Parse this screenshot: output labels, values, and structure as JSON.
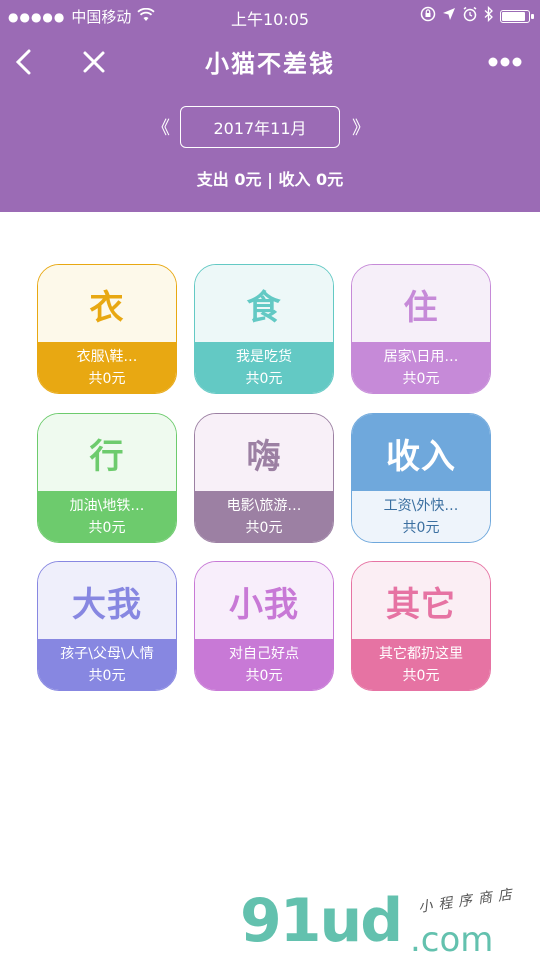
{
  "status_bar": {
    "signal": "●●●●●",
    "carrier": "中国移动",
    "time": "上午10:05"
  },
  "nav": {
    "title": "小猫不差钱"
  },
  "month": {
    "prev": "《",
    "label": "2017年11月",
    "next": "》"
  },
  "summary": {
    "text": "支出 0元 | 收入 0元"
  },
  "categories": [
    {
      "glyph": "衣",
      "desc": "衣服\\鞋…",
      "total": "共0元",
      "color": "#e8a812",
      "top_bg": "#fdf9ea"
    },
    {
      "glyph": "食",
      "desc": "我是吃货",
      "total": "共0元",
      "color": "#63c9c4",
      "top_bg": "#edf8f8"
    },
    {
      "glyph": "住",
      "desc": "居家\\日用…",
      "total": "共0元",
      "color": "#c68ad8",
      "top_bg": "#f6eff9"
    },
    {
      "glyph": "行",
      "desc": "加油\\地铁…",
      "total": "共0元",
      "color": "#6dcb6d",
      "top_bg": "#effaef"
    },
    {
      "glyph": "嗨",
      "desc": "电影\\旅游…",
      "total": "共0元",
      "color": "#9c80a3",
      "top_bg": "#f8f0f8"
    },
    {
      "glyph": "收入",
      "desc": "工资\\外快…",
      "total": "共0元",
      "color": "#6fa8dc",
      "top_bg": "#6fa8dc",
      "inverted": true
    },
    {
      "glyph": "大我",
      "desc": "孩子\\父母\\人情",
      "total": "共0元",
      "color": "#8787e1",
      "top_bg": "#efeffb"
    },
    {
      "glyph": "小我",
      "desc": "对自己好点",
      "total": "共0元",
      "color": "#c879d6",
      "top_bg": "#f8eefb"
    },
    {
      "glyph": "其它",
      "desc": "其它都扔这里",
      "total": "共0元",
      "color": "#e673a3",
      "top_bg": "#fbeef4"
    }
  ],
  "watermark": {
    "main": "91ud",
    "com": ".com",
    "cn": "小程序商店"
  },
  "colors": {
    "header": "#9b6bb5",
    "watermark": "#63c1ae"
  }
}
